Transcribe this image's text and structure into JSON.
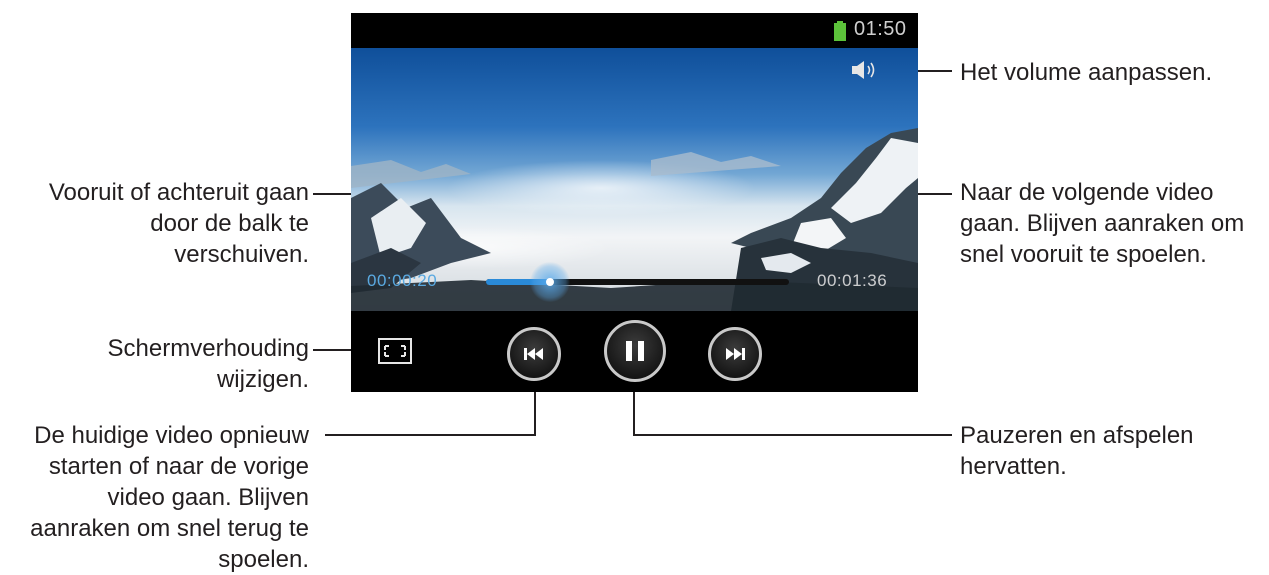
{
  "status_bar": {
    "time": "01:50",
    "battery_icon": "battery-full-icon",
    "battery_color": "#5cc23a"
  },
  "player": {
    "current_time": "00:00:20",
    "total_time": "00:01:36",
    "progress_fraction": 0.21,
    "accent_color": "#2a8ad8",
    "icons": {
      "volume": "volume-icon",
      "aspect_ratio": "aspect-ratio-icon",
      "previous": "skip-previous-icon",
      "pause": "pause-icon",
      "next": "skip-next-icon"
    }
  },
  "annotations": {
    "volume": "Het volume aanpassen.",
    "seek": "Vooruit of achteruit gaan\ndoor de balk te\nverschuiven.",
    "next": "Naar de volgende video\ngaan. Blijven aanraken om\nsnel vooruit te spoelen.",
    "ratio": "Schermverhouding\nwijzigen.",
    "previous": "De huidige video opnieuw\nstarten of naar de vorige\nvideo gaan. Blijven\naanraken om snel terug te\nspoelen.",
    "pause": "Pauzeren en afspelen\nhervatten."
  }
}
